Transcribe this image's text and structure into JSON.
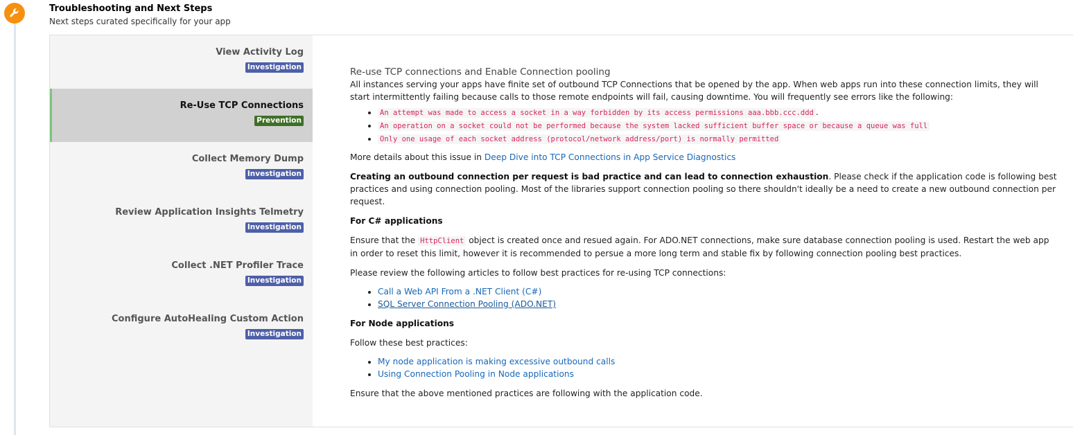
{
  "header": {
    "title": "Troubleshooting and Next Steps",
    "subtitle": "Next steps curated specifically for your app"
  },
  "colors": {
    "accent": "#f7900f",
    "investigation_badge": "#4e5fa8",
    "prevention_badge": "#3f6f27",
    "active_marker": "#7cc47e",
    "link": "#1767b8",
    "code_text": "#d6265a"
  },
  "nav": {
    "items": [
      {
        "label": "View Activity Log",
        "badge": "Investigation",
        "active": false
      },
      {
        "label": "Re-Use TCP Connections",
        "badge": "Prevention",
        "active": true
      },
      {
        "label": "Collect Memory Dump",
        "badge": "Investigation",
        "active": false
      },
      {
        "label": "Review Application Insights Telmetry",
        "badge": "Investigation",
        "active": false
      },
      {
        "label": "Collect .NET Profiler Trace",
        "badge": "Investigation",
        "active": false
      },
      {
        "label": "Configure AutoHealing Custom Action",
        "badge": "Investigation",
        "active": false
      }
    ]
  },
  "content": {
    "title": "Re-use TCP connections and Enable Connection pooling",
    "intro": "All instances serving your apps have finite set of outbound TCP Connections that be opened by the app. When web apps run into these connection limits, they will start intermittently failing because calls to those remote endpoints will fail, causing downtime. You will frequently see errors like the following:",
    "errors": [
      "An attempt was made to access a socket in a way forbidden by its access permissions aaa.bbb.ccc.ddd",
      "An operation on a socket could not be performed because the system lacked sufficient buffer space or because a queue was full",
      "Only one usage of each socket address (protocol/network address/port) is normally permitted"
    ],
    "error_suffix": ".",
    "details_prefix": "More details about this issue in ",
    "details_link": "Deep Dive into TCP Connections in App Service Diagnostics",
    "bad_practice_bold": "Creating an outbound connection per request is bad practice and can lead to connection exhaustion",
    "bad_practice_rest": ". Please check if the application code is following best practices and using connection pooling. Most of the libraries support connection pooling so there shouldn't ideally be a need to create a new outbound connection per request.",
    "csharp_heading": "For C# applications",
    "csharp_prefix": "Ensure that the ",
    "csharp_code": "HttpClient",
    "csharp_rest": " object is created once and resued again. For ADO.NET connections, make sure database connection pooling is used. Restart the web app in order to reset this limit, however it is recommended to persue a more long term and stable fix by following connection pooling best practices.",
    "articles_intro": "Please review the following articles to follow best practices for re-using TCP connections:",
    "csharp_links": [
      "Call a Web API From a .NET Client (C#)",
      "SQL Server Connection Pooling (ADO.NET)"
    ],
    "node_heading": "For Node applications",
    "node_intro": "Follow these best practices:",
    "node_links": [
      "My node application is making excessive outbound calls",
      "Using Connection Pooling in Node applications"
    ],
    "closing": "Ensure that the above mentioned practices are following with the application code."
  }
}
